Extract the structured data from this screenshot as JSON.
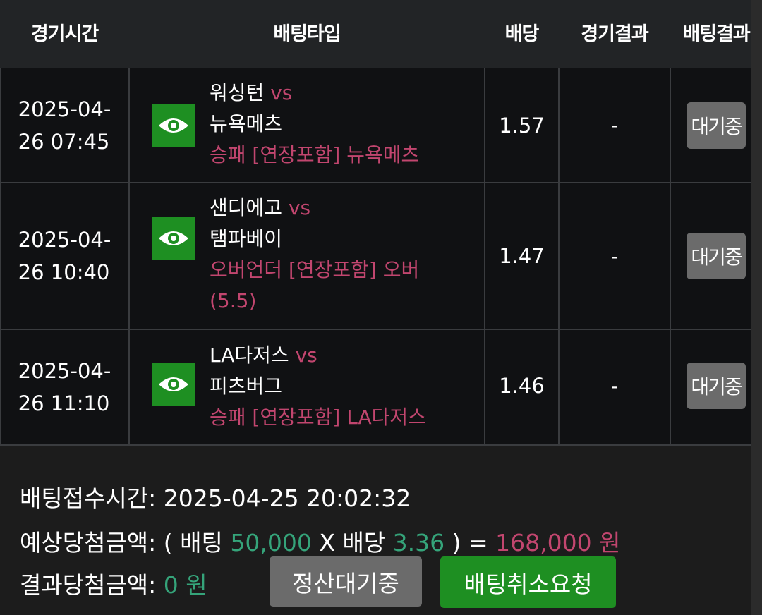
{
  "header": {
    "time": "경기시간",
    "bet_type": "배팅타입",
    "odds": "배당",
    "game_result": "경기결과",
    "bet_result": "배팅결과"
  },
  "rows": [
    {
      "time_line1": "2025-04-",
      "time_line2": "26 07:45",
      "home": "워싱턴",
      "vs": "vs",
      "away": "뉴욕메츠",
      "pick_line1": "승패 [연장포함] 뉴욕메츠",
      "pick_line2": "",
      "odds": "1.57",
      "result": "-",
      "status": "대기중"
    },
    {
      "time_line1": "2025-04-",
      "time_line2": "26 10:40",
      "home": "샌디에고",
      "vs": "vs",
      "away": "탬파베이",
      "pick_line1": "오버언더 [연장포함] 오버",
      "pick_line2": "(5.5)",
      "odds": "1.47",
      "result": "-",
      "status": "대기중"
    },
    {
      "time_line1": "2025-04-",
      "time_line2": "26 11:10",
      "home": "LA다저스",
      "vs": "vs",
      "away": "피츠버그",
      "pick_line1": "승패 [연장포함] LA다저스",
      "pick_line2": "",
      "odds": "1.46",
      "result": "-",
      "status": "대기중"
    }
  ],
  "footer": {
    "bet_time_label": "배팅접수시간:",
    "bet_time_value": "2025-04-25 20:02:32",
    "expected_label": "예상당첨금액:",
    "open_paren": "( 배팅",
    "bet_amount": "50,000",
    "x_odds": "X 배당",
    "total_odds": "3.36",
    "close_eq": ") =",
    "expected_amount": "168,000 원",
    "result_label": "결과당첨금액:",
    "result_amount": "0 원",
    "settle_button": "정산대기중",
    "cancel_button": "배팅취소요청"
  },
  "colors": {
    "accent_pink": "#c2466f",
    "accent_green": "#35a47a",
    "button_green": "#1e8f22",
    "button_gray": "#6b6b6b"
  },
  "icons": [
    "eye-icon"
  ]
}
